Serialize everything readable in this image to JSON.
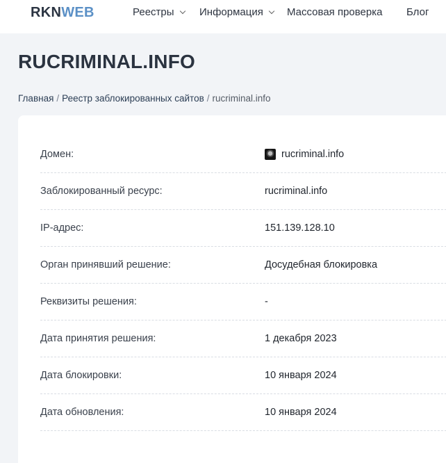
{
  "header": {
    "logo_part1": "RKN",
    "logo_part2": "WEB",
    "nav": [
      {
        "label": "Реестры"
      },
      {
        "label": "Информация"
      },
      {
        "label": "Массовая проверка"
      },
      {
        "label": "Блог"
      }
    ]
  },
  "page": {
    "title": "RUCRIMINAL.INFO"
  },
  "breadcrumb": {
    "home": "Главная",
    "separator": "/",
    "registry": "Реестр заблокированных сайтов",
    "current": "rucriminal.info"
  },
  "details": [
    {
      "label": "Домен:",
      "value": "rucriminal.info",
      "icon": "site-favicon-icon"
    },
    {
      "label": "Заблокированный ресурс:",
      "value": "rucriminal.info"
    },
    {
      "label": "IP-адрес:",
      "value": "151.139.128.10"
    },
    {
      "label": "Орган принявший решение:",
      "value": "Досудебная блокировка"
    },
    {
      "label": "Реквизиты решения:",
      "value": "-"
    },
    {
      "label": "Дата принятия решения:",
      "value": "1 декабря 2023"
    },
    {
      "label": "Дата блокировки:",
      "value": "10 января 2024"
    },
    {
      "label": "Дата обновления:",
      "value": "10 января 2024"
    }
  ],
  "colors": {
    "logo_dark": "#2b3442",
    "logo_accent": "#5b90c6",
    "page_background": "#f2f4f7",
    "card_background": "#ffffff"
  }
}
